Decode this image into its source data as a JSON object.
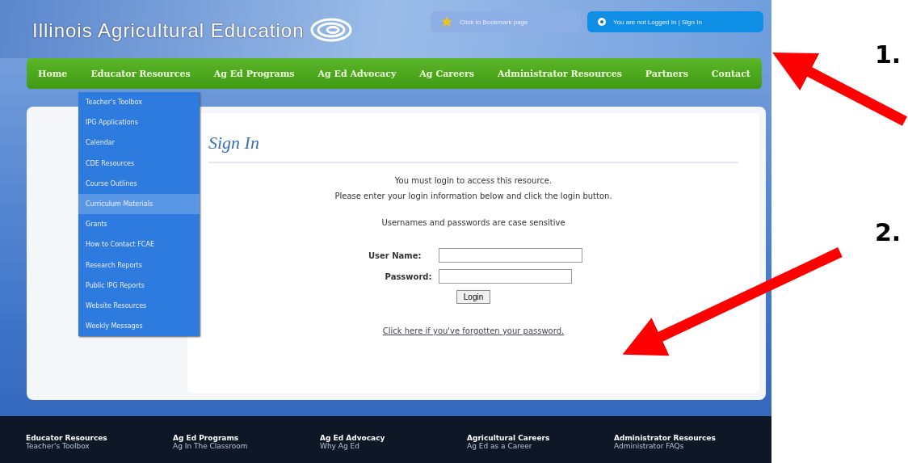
{
  "header": {
    "site_title": "Illinois Agricultural Education",
    "bookmark_button": "Click to Bookmark page",
    "login_status": "You are not Logged In | Sign In"
  },
  "nav": {
    "items": [
      "Home",
      "Educator Resources",
      "Ag Ed Programs",
      "Ag Ed Advocacy",
      "Ag Careers",
      "Administrator Resources",
      "Partners",
      "Contact"
    ]
  },
  "dropdown": {
    "items": [
      {
        "label": "Teacher's Toolbox",
        "selected": false
      },
      {
        "label": "IPG Applications",
        "selected": false
      },
      {
        "label": "Calendar",
        "selected": false
      },
      {
        "label": "CDE Resources",
        "selected": false
      },
      {
        "label": "Course Outlines",
        "selected": false
      },
      {
        "label": "Curriculum Materials",
        "selected": true
      },
      {
        "label": "Grants",
        "selected": false
      },
      {
        "label": "How to Contact FCAE",
        "selected": false
      },
      {
        "label": "Research Reports",
        "selected": false
      },
      {
        "label": "Public IPG Reports",
        "selected": false
      },
      {
        "label": "Website Resources",
        "selected": false
      },
      {
        "label": "Weekly Messages",
        "selected": false
      }
    ]
  },
  "sign_in": {
    "title": "Sign In",
    "message_lines": [
      "You must login to access this resource.",
      "Please enter your login information below and click the login button."
    ],
    "case_note": "Usernames and passwords are case sensitive",
    "username_label": "User Name:",
    "password_label": "Password:",
    "login_button": "Login",
    "forgot_link": "Click here if you've forgotten your password."
  },
  "footer": {
    "columns": [
      {
        "heading": "Educator Resources",
        "link": "Teacher's Toolbox"
      },
      {
        "heading": "Ag Ed Programs",
        "link": "Ag In The Classroom"
      },
      {
        "heading": "Ag Ed Advocacy",
        "link": "Why Ag Ed"
      },
      {
        "heading": "Agricultural Careers",
        "link": "Ag Ed as a Career"
      },
      {
        "heading": "Administrator Resources",
        "link": "Administrator FAQs"
      }
    ]
  },
  "annotations": [
    "1.",
    "2."
  ]
}
